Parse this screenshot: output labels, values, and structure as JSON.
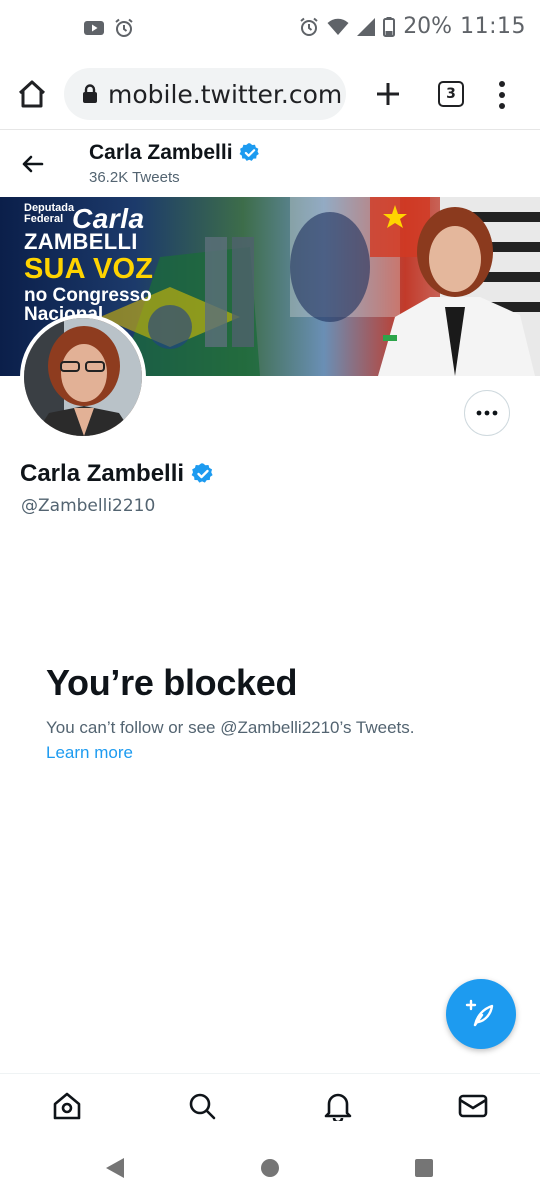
{
  "status_bar": {
    "battery_percent": "20%",
    "time": "11:15",
    "left_icons": [
      "youtube-icon",
      "alarm-icon"
    ],
    "right_icons": [
      "alarm-icon",
      "wifi-icon",
      "signal-icon",
      "battery-icon"
    ]
  },
  "browser": {
    "url": "mobile.twitter.com",
    "tab_count": "3"
  },
  "header": {
    "name": "Carla Zambelli",
    "tweet_count": "36.2K Tweets"
  },
  "banner": {
    "line_small": "Deputada Federal",
    "line_carla": "Carla",
    "line_zambelli": "ZAMBELLI",
    "line_sua_voz": "SUA VOZ",
    "line_no_congresso": "no Congresso",
    "line_nacional": "Nacional"
  },
  "profile": {
    "name": "Carla Zambelli",
    "handle": "@Zambelli2210",
    "verified": true
  },
  "blocked": {
    "title": "You’re blocked",
    "description": "You can’t follow or see @Zambelli2210’s Tweets.",
    "link": "Learn more"
  },
  "colors": {
    "accent": "#1d9bf0",
    "text_primary": "#0f1419",
    "text_secondary": "#536471"
  },
  "bottom_nav": [
    "home-icon",
    "search-icon",
    "notifications-icon",
    "messages-icon"
  ]
}
